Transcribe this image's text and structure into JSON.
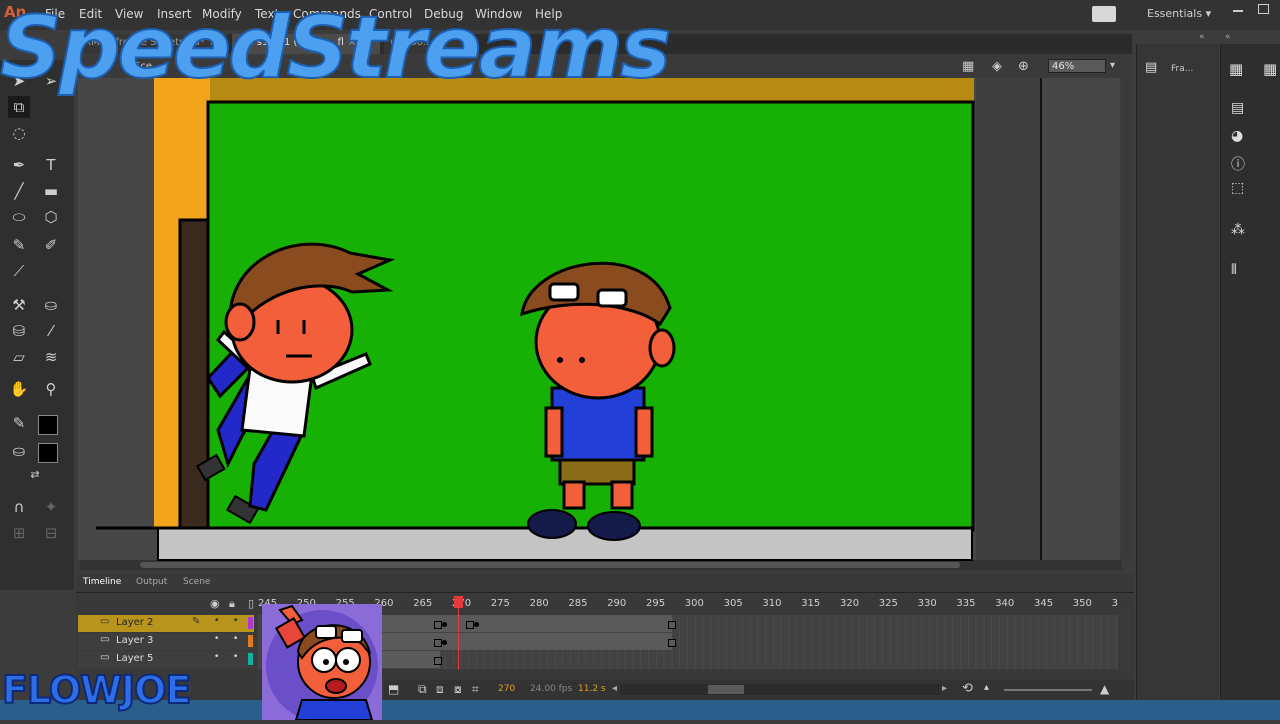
{
  "app": {
    "logo": "An"
  },
  "menu": [
    "File",
    "Edit",
    "View",
    "Insert",
    "Modify",
    "Text",
    "Commands",
    "Control",
    "Debug",
    "Window",
    "Help"
  ],
  "workspace": "Essentials",
  "tabs": [
    {
      "label": "RM Refrence Sheets.fla*"
    },
    {
      "label": "RM s1 ep1 (Scene...fl"
    },
    {
      "label": "weboo..."
    }
  ],
  "edit_bar": {
    "scene": "Sce...",
    "zoom": "46%"
  },
  "right_panel": {
    "frame_label": "Fra..."
  },
  "overlay": {
    "title": "SpeedStreams",
    "brand": "FLOWJOE"
  },
  "timeline": {
    "tabs": [
      "Timeline",
      "Output",
      "Scene"
    ],
    "frame_numbers": [
      "245",
      "250",
      "255",
      "260",
      "265",
      "270",
      "275",
      "280",
      "285",
      "290",
      "295",
      "300",
      "305",
      "310",
      "315",
      "320",
      "325",
      "330",
      "335",
      "340",
      "345",
      "350",
      "3"
    ],
    "layers": [
      {
        "name": "Layer 2",
        "selected": true,
        "color": "#b038d0"
      },
      {
        "name": "Layer 3",
        "selected": false,
        "color": "#e07a1c"
      },
      {
        "name": "Layer 5",
        "selected": false,
        "color": "#14b0a0"
      }
    ],
    "current_frame": "270",
    "fps": "24.00 fps",
    "time": "11.2 s"
  },
  "colors": {
    "stage": "#17b004",
    "accent": "#4d9ff0",
    "playhead": "#e23a3a"
  }
}
